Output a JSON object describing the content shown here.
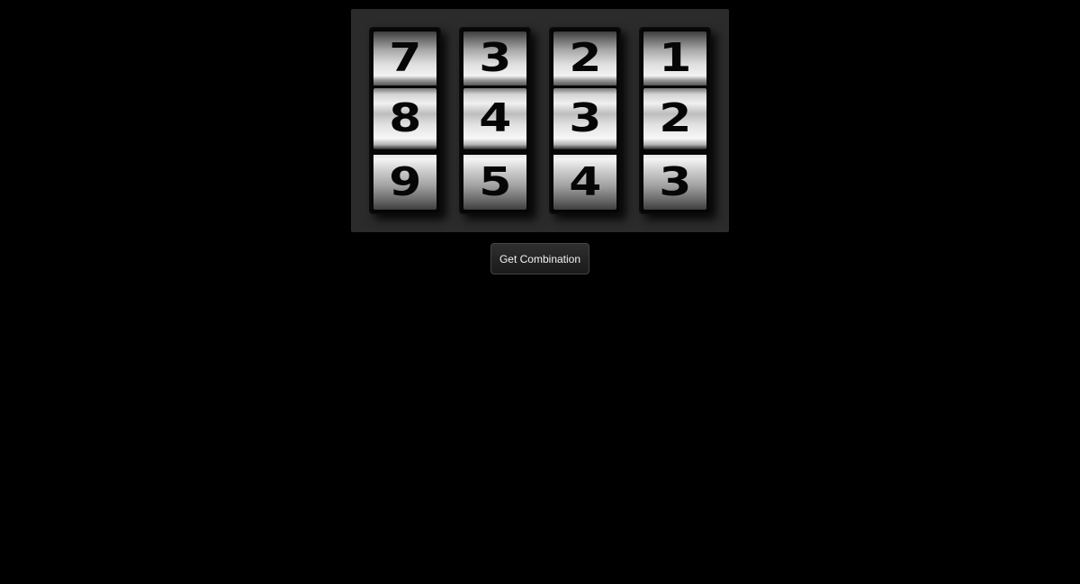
{
  "lock": {
    "dials": [
      {
        "above": "7",
        "current": "8",
        "below": "9"
      },
      {
        "above": "3",
        "current": "4",
        "below": "5"
      },
      {
        "above": "2",
        "current": "3",
        "below": "4"
      },
      {
        "above": "1",
        "current": "2",
        "below": "3"
      }
    ]
  },
  "actions": {
    "get_combination_label": "Get Combination"
  },
  "colors": {
    "background": "#000000",
    "panel": "#2b2b2b",
    "button_text": "#f2f2f2"
  }
}
